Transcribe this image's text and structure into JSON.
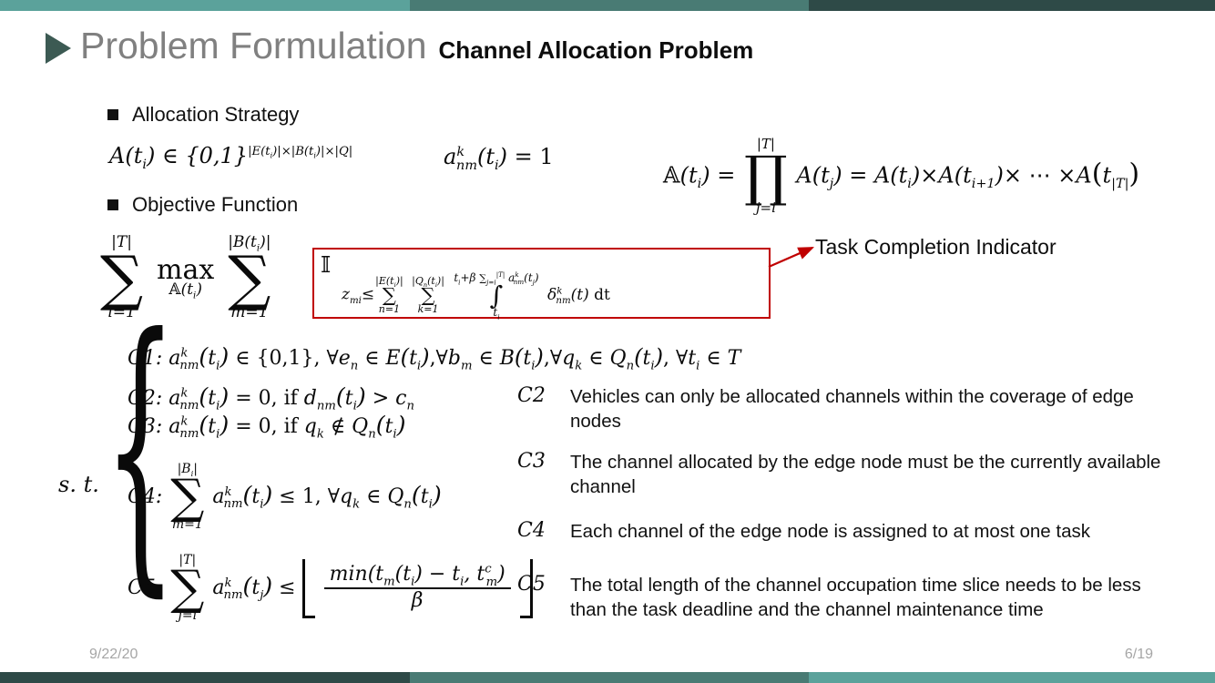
{
  "theme": {
    "accent_light": "#5ba29b",
    "accent_mid": "#497b74",
    "accent_dark": "#2e4a47",
    "title_gray": "#808080",
    "highlight_red": "#c00000",
    "body_black": "#111111",
    "footer_gray": "#a6a6a6"
  },
  "header": {
    "marker_icon": "play-triangle-icon",
    "title": "Problem Formulation",
    "subtitle": "Channel Allocation Problem"
  },
  "sections": {
    "allocation_strategy": {
      "bullet_icon": "square-bullet-icon",
      "label": "Allocation Strategy",
      "equations": {
        "eq1": {
          "lhs": "A(t",
          "lhs_sub": "i",
          "mid": ") ∈ {0,1}",
          "exponent": "|E(t_i)|×|B(t_i)|×|Q|",
          "plain": "A(t_i) ∈ {0,1}^(|E(t_i)|×|B(t_i)|×|Q|)"
        },
        "eq2": {
          "plain": "a^k_nm(t_i) = 1",
          "base": "a",
          "sup": "k",
          "sub": "nm",
          "arg": "(t",
          "arg_sub": "i",
          "tail": ") = 1"
        },
        "eq3": {
          "plain": "𝔸(t_i) = ∏_{j=i}^{|T|} A(t_j) = A(t_i)×A(t_{i+1})×⋯×A(t_{|T|})",
          "lhs": "𝔸(t",
          "lhs_sub": "i",
          "eq": ") =",
          "prod_upper": "|T|",
          "prod_glyph": "∏",
          "prod_lower": "j=i",
          "rhs1": "A(t",
          "rhs1_sub": "j",
          "rhs1_tail": ") =",
          "rhs2": "A(t",
          "rhs2_sub": "i",
          "rhs2_tail": ")×A(t",
          "rhs3_sub": "i+1",
          "rhs3_tail": ")× ⋯ ×A(t",
          "rhs4_sub": "|T|",
          "rhs4_tail": ")"
        }
      }
    },
    "objective_function": {
      "bullet_icon": "square-bullet-icon",
      "label": "Objective Function",
      "objective": {
        "sum1_upper": "|T|",
        "sum1_glyph": "∑",
        "sum1_lower": "i=1",
        "max_op": "max",
        "max_sub": "𝔸(t_i)",
        "sum2_upper": "|B(t_i)|",
        "sum2_glyph": "∑",
        "sum2_lower": "m=1",
        "indicator_glyph": "𝕀",
        "indicator_condition": "z_mi ≤ ∑_{n=1}^{|E(t_i)|} ∑_{k=1}^{|Q_n(t_i)|} ∫_{t_i}^{t_i+β ∑_{j=i}^{|T|} a^k_nm(t_j)} δ^k_nm(t) dt"
      },
      "annotation": {
        "text": "Task Completion Indicator",
        "arrow_icon": "arrow-right-icon",
        "color": "#c00000"
      }
    },
    "constraints": {
      "st_label": "s. t.",
      "brace_icon": "left-curly-brace-icon",
      "items": [
        {
          "id": "C1",
          "plain": "C1: a^k_nm(t_i) ∈ {0,1}, ∀e_n ∈ E(t_i), ∀b_m ∈ B(t_i), ∀q_k ∈ Q_n(t_i), ∀t_i ∈ T"
        },
        {
          "id": "C2",
          "plain": "C2: a^k_nm(t_i) = 0, if d_nm(t_i) > c_n"
        },
        {
          "id": "C3",
          "plain": "C3: a^k_nm(t_i) = 0, if q_k ∉ Q_n(t_i)"
        },
        {
          "id": "C4",
          "plain": "C4: ∑_{m=1}^{|B_i|} a^k_nm(t_i) ≤ 1, ∀q_k ∈ Q_n(t_i)",
          "sum_upper": "|B_i|",
          "sum_lower": "m=1"
        },
        {
          "id": "C5",
          "plain": "C5: ∑_{j=i}^{|T|} a^k_nm(t_j) ≤ ⌊ min(t_m(t_i) − t_i, t^c_m) / β ⌋",
          "sum_upper": "|T|",
          "sum_lower": "j=i",
          "frac_num": "min(t_m(t_i) − t_i, t^c_m)",
          "frac_den": "β"
        }
      ]
    },
    "explanations": [
      {
        "tag": "C2",
        "text": "Vehicles can only be allocated channels within the coverage of edge nodes"
      },
      {
        "tag": "C3",
        "text": "The channel allocated by the edge node must be the currently available channel"
      },
      {
        "tag": "C4",
        "text": "Each channel of the edge node is assigned to at most one task"
      },
      {
        "tag": "C5",
        "text": "The total length of the channel occupation time slice needs to be less than the task deadline and the channel maintenance time"
      }
    ]
  },
  "footer": {
    "date": "9/22/20",
    "page": "6/19"
  }
}
